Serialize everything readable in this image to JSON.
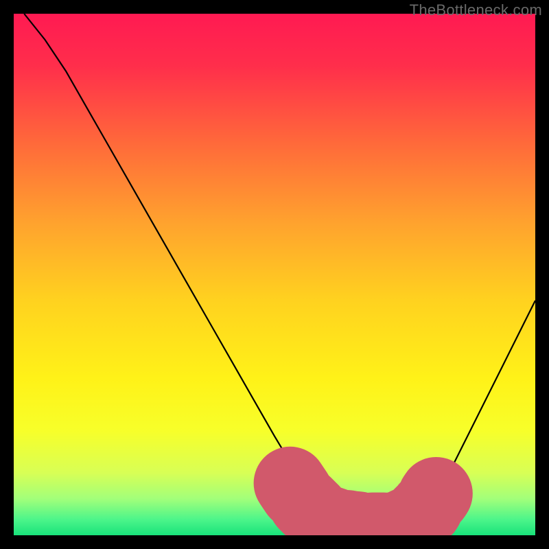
{
  "attribution": "TheBottleneck.com",
  "chart_data": {
    "type": "line",
    "title": "",
    "xlabel": "",
    "ylabel": "",
    "xlim": [
      0,
      100
    ],
    "ylim": [
      0,
      100
    ],
    "series": [
      {
        "name": "curve",
        "x": [
          2,
          6,
          10,
          14,
          18,
          22,
          26,
          30,
          34,
          38,
          42,
          46,
          50,
          53,
          56,
          59,
          62,
          65,
          68,
          71,
          74,
          77,
          80,
          83,
          86,
          90,
          94,
          98,
          100
        ],
        "y": [
          100,
          95,
          89,
          82,
          75,
          68,
          61,
          54,
          47,
          40,
          33,
          26,
          19,
          14,
          9,
          5,
          2.5,
          1.5,
          1.2,
          1.2,
          1.5,
          3,
          6,
          11,
          17,
          25,
          33,
          41,
          45
        ]
      },
      {
        "name": "highlight",
        "x": [
          53,
          55,
          57,
          59,
          62,
          65,
          68,
          71,
          74,
          77,
          79,
          81
        ],
        "y": [
          10,
          7,
          5,
          3,
          2,
          1.5,
          1.2,
          1.2,
          1.5,
          3,
          5,
          8
        ]
      }
    ],
    "gradient_stops": [
      {
        "offset": 0.0,
        "color": "#ff1a52"
      },
      {
        "offset": 0.1,
        "color": "#ff2e4b"
      },
      {
        "offset": 0.25,
        "color": "#ff6a3a"
      },
      {
        "offset": 0.4,
        "color": "#ffa22e"
      },
      {
        "offset": 0.55,
        "color": "#ffd21f"
      },
      {
        "offset": 0.7,
        "color": "#fff218"
      },
      {
        "offset": 0.8,
        "color": "#f7ff2a"
      },
      {
        "offset": 0.88,
        "color": "#d8ff55"
      },
      {
        "offset": 0.93,
        "color": "#a2ff7a"
      },
      {
        "offset": 0.97,
        "color": "#4cf58a"
      },
      {
        "offset": 1.0,
        "color": "#19e27a"
      }
    ],
    "colors": {
      "curve": "#000000",
      "highlight": "#d1596b",
      "background_frame": "#000000"
    }
  }
}
